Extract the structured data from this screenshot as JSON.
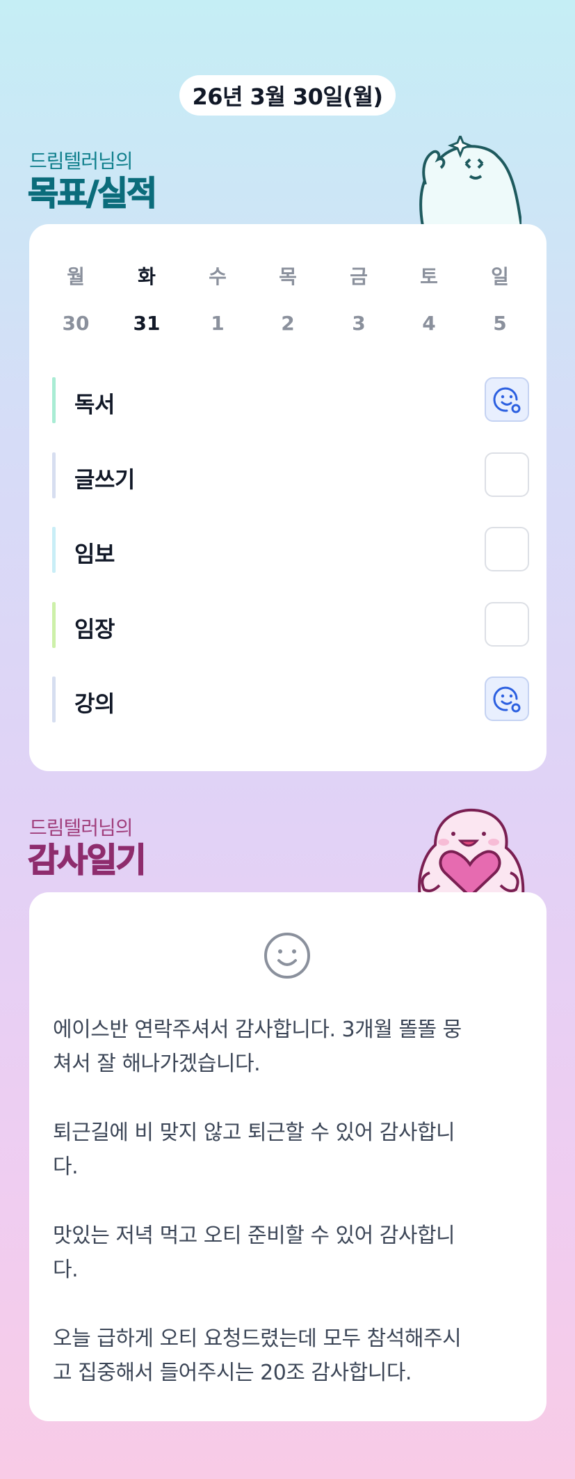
{
  "header": {
    "date": "26년 3월 30일(월)"
  },
  "goals_section": {
    "caption": "드림텔러님의",
    "title": "목표/실적",
    "mascot_icon": "waving-ghost-mascot-icon",
    "week": {
      "days": [
        "월",
        "화",
        "수",
        "목",
        "금",
        "토",
        "일"
      ],
      "dates": [
        "30",
        "31",
        "1",
        "2",
        "3",
        "4",
        "5"
      ],
      "active_index": 1
    },
    "goals": [
      {
        "label": "독서",
        "bar_color": "#a9ecd4",
        "done": true,
        "icon": "smile-check-icon"
      },
      {
        "label": "글쓰기",
        "bar_color": "#d7def0",
        "done": false,
        "icon": ""
      },
      {
        "label": "임보",
        "bar_color": "#c9eef7",
        "done": false,
        "icon": ""
      },
      {
        "label": "임장",
        "bar_color": "#cdf0a9",
        "done": false,
        "icon": ""
      },
      {
        "label": "강의",
        "bar_color": "#d6def0",
        "done": true,
        "icon": "smile-check-icon"
      }
    ]
  },
  "diary_section": {
    "caption": "드림텔러님의",
    "title": "감사일기",
    "mascot_icon": "heart-holding-mascot-icon",
    "mood_icon": "smile-icon",
    "entries": [
      {
        "line1": "에이스반 연락주셔서 감사합니다. 3개월 똘똘 뭉",
        "line2": "쳐서 잘 해나가겠습니다."
      },
      {
        "line1": "퇴근길에 비 맞지 않고 퇴근할 수 있어 감사합니",
        "line2": "다."
      },
      {
        "line1": "맛있는 저녁 먹고 오티 준비할 수 있어 감사합니",
        "line2": "다."
      },
      {
        "line1": "오늘 급하게 오티 요청드렸는데 모두 참석해주시",
        "line2": "고 집중해서 들어주시는 20조 감사합니다."
      }
    ]
  },
  "colors": {
    "accent_blue": "#2b5fe0",
    "goals_title": "#0b6c7b",
    "diary_title": "#8e2c6d"
  }
}
